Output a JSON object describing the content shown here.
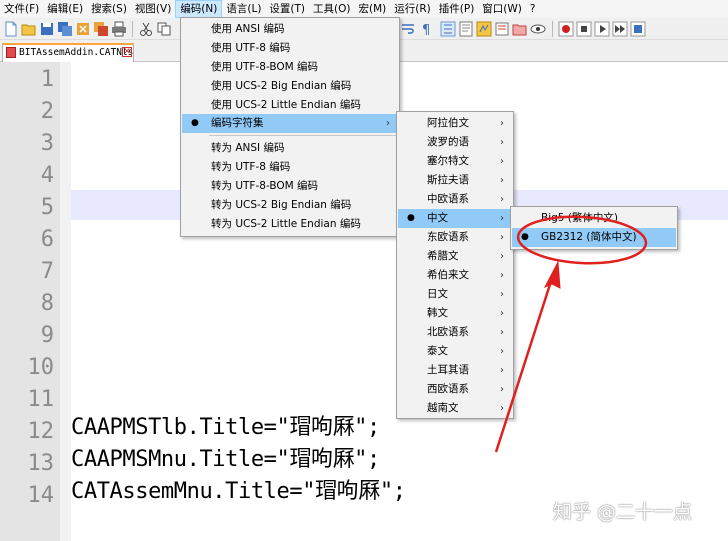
{
  "menubar": [
    {
      "label": "文件(F)"
    },
    {
      "label": "编辑(E)"
    },
    {
      "label": "搜索(S)"
    },
    {
      "label": "视图(V)"
    },
    {
      "label": "编码(N)",
      "active": true
    },
    {
      "label": "语言(L)"
    },
    {
      "label": "设置(T)"
    },
    {
      "label": "工具(O)"
    },
    {
      "label": "宏(M)"
    },
    {
      "label": "运行(R)"
    },
    {
      "label": "插件(P)"
    },
    {
      "label": "窗口(W)"
    },
    {
      "label": "?"
    }
  ],
  "tab": {
    "filename": "BITAssemAddin.CATNls",
    "close_glyph": "✕"
  },
  "editor": {
    "line_numbers": [
      "1",
      "2",
      "3",
      "4",
      "5",
      "6",
      "7",
      "8",
      "9",
      "10",
      "11",
      "12",
      "13",
      "14"
    ],
    "lines": [
      {
        "n": 12,
        "text": "CAAPMSTlb.Title=\"瑁呴厤\";"
      },
      {
        "n": 13,
        "text": "CAAPMSMnu.Title=\"瑁呴厤\";"
      },
      {
        "n": 14,
        "text": "CATAssemMnu.Title=\"瑁呴厤\";"
      }
    ],
    "current_line": 5
  },
  "encoding_menu": {
    "items": [
      {
        "label": "使用 ANSI 编码"
      },
      {
        "label": "使用 UTF-8 编码"
      },
      {
        "label": "使用 UTF-8-BOM 编码"
      },
      {
        "label": "使用 UCS-2 Big Endian 编码"
      },
      {
        "label": "使用 UCS-2 Little Endian 编码"
      },
      {
        "label": "编码字符集",
        "submenu": true,
        "highlighted": true,
        "bullet": true
      },
      {
        "label": "转为 ANSI 编码"
      },
      {
        "label": "转为 UTF-8 编码"
      },
      {
        "label": "转为 UTF-8-BOM 编码"
      },
      {
        "label": "转为 UCS-2 Big Endian 编码"
      },
      {
        "label": "转为 UCS-2 Little Endian 编码"
      }
    ]
  },
  "charset_menu": {
    "items": [
      {
        "label": "阿拉伯文"
      },
      {
        "label": "波罗的语"
      },
      {
        "label": "塞尔特文"
      },
      {
        "label": "斯拉夫语"
      },
      {
        "label": "中欧语系"
      },
      {
        "label": "中文",
        "highlighted": true,
        "bullet": true
      },
      {
        "label": "东欧语系"
      },
      {
        "label": "希腊文"
      },
      {
        "label": "希伯来文"
      },
      {
        "label": "日文"
      },
      {
        "label": "韩文"
      },
      {
        "label": "北欧语系"
      },
      {
        "label": "泰文"
      },
      {
        "label": "土耳其语"
      },
      {
        "label": "西欧语系"
      },
      {
        "label": "越南文"
      }
    ]
  },
  "chinese_menu": {
    "items": [
      {
        "label": "Big5 (繁体中文)"
      },
      {
        "label": "GB2312 (简体中文)",
        "highlighted": true,
        "bullet": true
      }
    ]
  },
  "submenu_arrow": "›",
  "bullet_glyph": "●",
  "watermark": "知乎 @二十一点",
  "colors": {
    "highlight": "#91c9f7",
    "annotation": "#e0201e",
    "tab_accent": "#ffa53c"
  }
}
